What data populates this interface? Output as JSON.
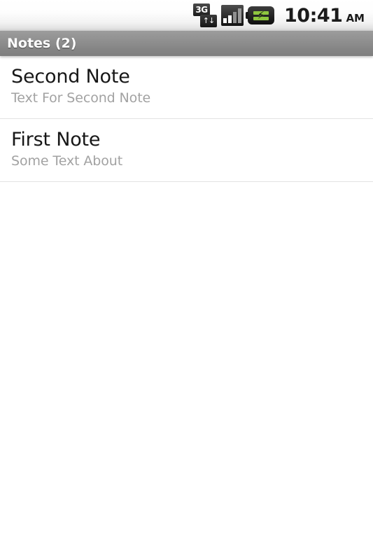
{
  "status_bar": {
    "network_icon": "3g-data-icon",
    "network_label": "3G",
    "network_arrows": "↑↓",
    "signal_icon": "signal-bars-icon",
    "battery_icon": "battery-charging-icon",
    "battery_bolt": "⚡",
    "time": "10:41",
    "meridiem": "AM"
  },
  "title_bar": {
    "title": "Notes (2)"
  },
  "notes": [
    {
      "title": "Second Note",
      "subtitle": "Text For Second Note"
    },
    {
      "title": "First Note",
      "subtitle": "Some Text About"
    }
  ],
  "colors": {
    "title_bar_bg": "#8e8e8e",
    "title_text": "#ffffff",
    "note_title": "#171717",
    "note_subtitle": "#a2a2a2",
    "divider": "#e3e3e3",
    "battery_green": "#8ec63f",
    "page_bg": "#ffffff"
  }
}
